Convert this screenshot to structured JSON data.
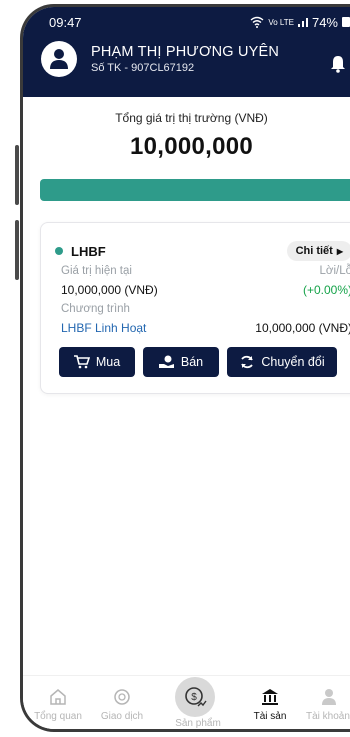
{
  "status_bar": {
    "time": "09:47",
    "network": "Vo LTE",
    "battery": "74%"
  },
  "account": {
    "name": "PHẠM THỊ PHƯƠNG UYÊN",
    "number": "Số TK - 907CL67192"
  },
  "summary": {
    "label": "Tổng giá trị thị trường (VNĐ)",
    "value": "10,000,000",
    "fill_fraction": 1.0,
    "bar_color": "#2e9b8a"
  },
  "holding": {
    "fund": "LHBF",
    "detail_label": "Chi tiết",
    "current_value_label": "Giá trị hiện tại",
    "current_value": "10,000,000 (VNĐ)",
    "pnl_label": "Lời/Lỗ",
    "pnl": "(+0.00%)",
    "program_label": "Chương trình",
    "program_name": "LHBF Linh Hoạt",
    "program_value": "10,000,000 (VNĐ)",
    "actions": {
      "buy": "Mua",
      "sell": "Bán",
      "convert": "Chuyển đổi"
    }
  },
  "nav": {
    "overview": "Tổng quan",
    "transactions": "Giao dịch",
    "products": "Sản phẩm",
    "assets": "Tài sản",
    "account": "Tài khoản"
  },
  "colors": {
    "primary": "#0d1b42",
    "accent": "#2e9b8a",
    "gain": "#16a34a",
    "link": "#2367b0"
  }
}
